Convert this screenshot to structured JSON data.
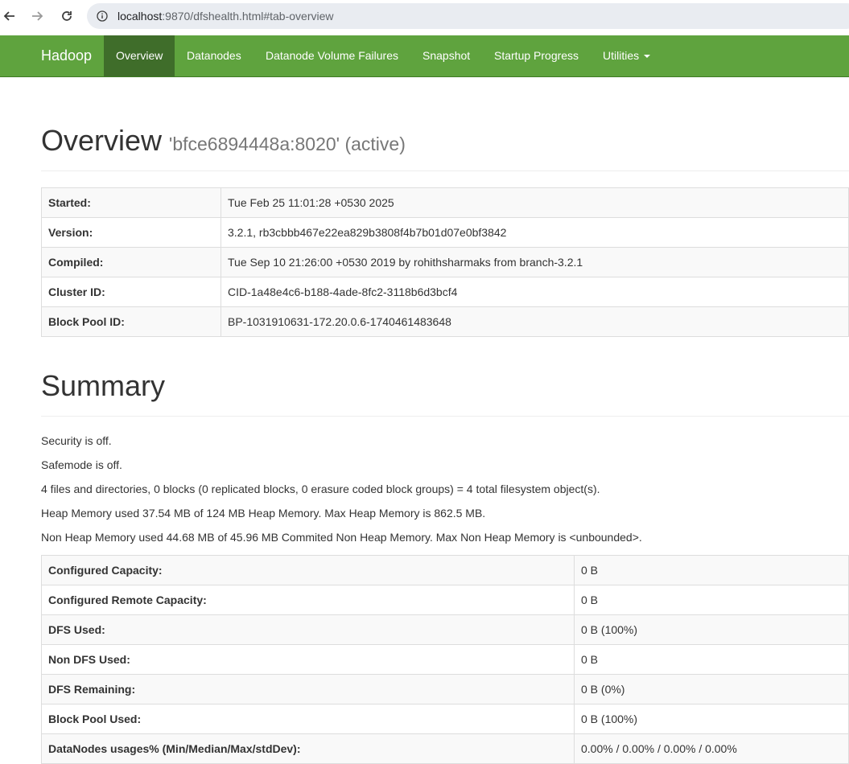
{
  "browser": {
    "url_host": "localhost",
    "url_rest": ":9870/dfshealth.html#tab-overview"
  },
  "navbar": {
    "brand": "Hadoop",
    "items": [
      {
        "label": "Overview",
        "active": true
      },
      {
        "label": "Datanodes"
      },
      {
        "label": "Datanode Volume Failures"
      },
      {
        "label": "Snapshot"
      },
      {
        "label": "Startup Progress"
      },
      {
        "label": "Utilities"
      }
    ]
  },
  "overview": {
    "title": "Overview",
    "subtitle": "'bfce6894448a:8020' (active)",
    "rows": [
      {
        "key": "Started:",
        "value": "Tue Feb 25 11:01:28 +0530 2025"
      },
      {
        "key": "Version:",
        "value": "3.2.1, rb3cbbb467e22ea829b3808f4b7b01d07e0bf3842"
      },
      {
        "key": "Compiled:",
        "value": "Tue Sep 10 21:26:00 +0530 2019 by rohithsharmaks from branch-3.2.1"
      },
      {
        "key": "Cluster ID:",
        "value": "CID-1a48e4c6-b188-4ade-8fc2-3118b6d3bcf4"
      },
      {
        "key": "Block Pool ID:",
        "value": "BP-1031910631-172.20.0.6-1740461483648"
      }
    ]
  },
  "summary": {
    "title": "Summary",
    "lines": [
      "Security is off.",
      "Safemode is off.",
      "4 files and directories, 0 blocks (0 replicated blocks, 0 erasure coded block groups) = 4 total filesystem object(s).",
      "Heap Memory used 37.54 MB of 124 MB Heap Memory. Max Heap Memory is 862.5 MB.",
      "Non Heap Memory used 44.68 MB of 45.96 MB Commited Non Heap Memory. Max Non Heap Memory is <unbounded>."
    ],
    "rows": [
      {
        "key": "Configured Capacity:",
        "value": "0 B"
      },
      {
        "key": "Configured Remote Capacity:",
        "value": "0 B"
      },
      {
        "key": "DFS Used:",
        "value": "0 B (100%)"
      },
      {
        "key": "Non DFS Used:",
        "value": "0 B"
      },
      {
        "key": "DFS Remaining:",
        "value": "0 B (0%)"
      },
      {
        "key": "Block Pool Used:",
        "value": "0 B (100%)"
      },
      {
        "key": "DataNodes usages% (Min/Median/Max/stdDev):",
        "value": "0.00% / 0.00% / 0.00% / 0.00%"
      }
    ]
  },
  "colors": {
    "navbar": "#5fa33e",
    "navbar_active": "#3f6d2a"
  }
}
